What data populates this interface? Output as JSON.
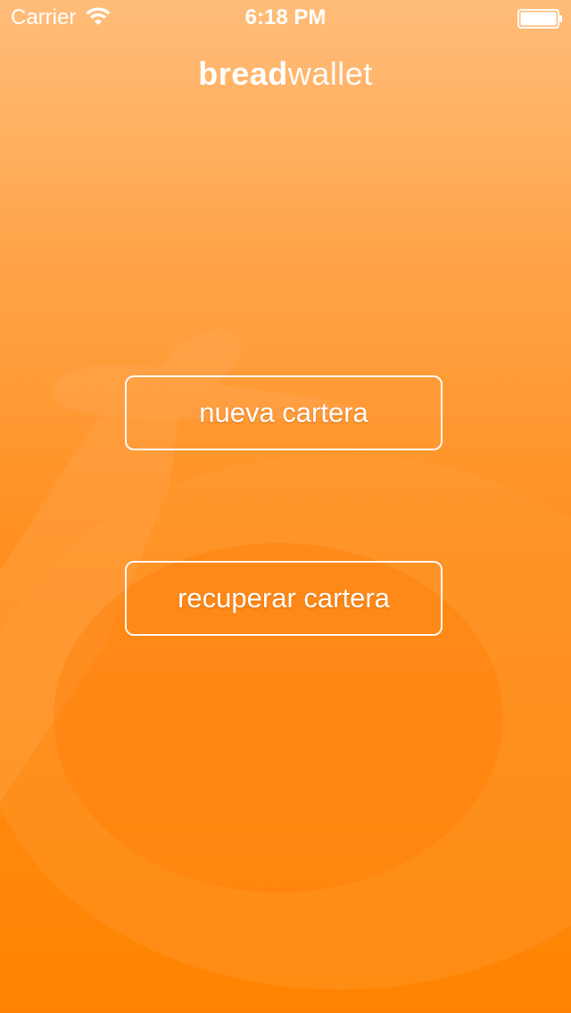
{
  "status_bar": {
    "carrier": "Carrier",
    "time": "6:18 PM",
    "wifi_icon": "wifi-icon",
    "battery_icon": "battery-icon"
  },
  "logo": {
    "part_bold": "bread",
    "part_thin": "wallet"
  },
  "actions": {
    "new_wallet_label": "nueva cartera",
    "recover_wallet_label": "recuperar cartera"
  },
  "colors": {
    "gradient_top": "#ffbd7a",
    "gradient_bottom": "#ff8300",
    "text": "#ffffff"
  }
}
